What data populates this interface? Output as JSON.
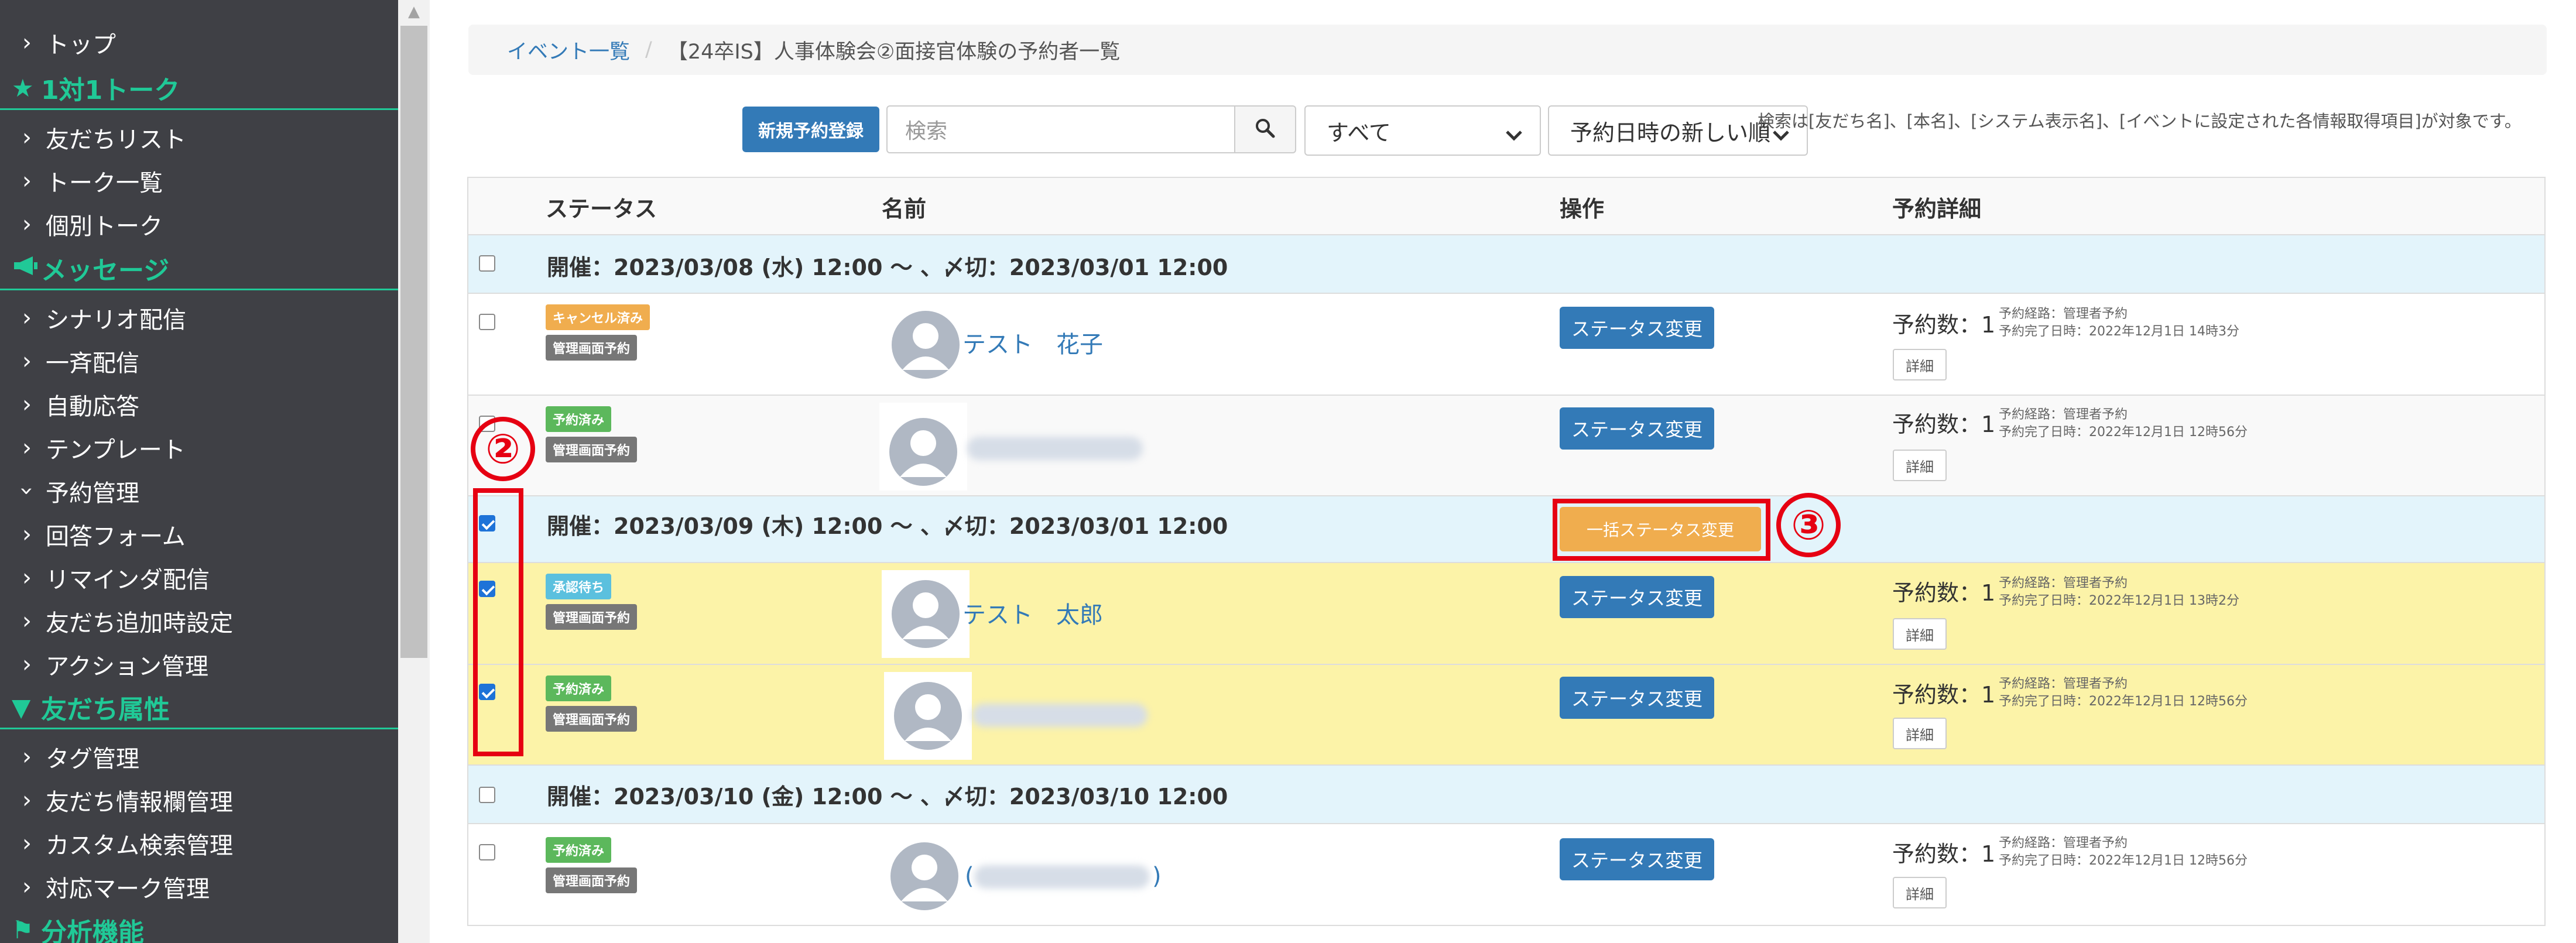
{
  "sidebar": {
    "items": [
      {
        "kind": "item",
        "label": "トップ"
      },
      {
        "kind": "section",
        "label": "1対1トーク",
        "icon": "star-icon"
      },
      {
        "kind": "item",
        "label": "友だちリスト"
      },
      {
        "kind": "item",
        "label": "トーク一覧"
      },
      {
        "kind": "item",
        "label": "個別トーク"
      },
      {
        "kind": "section",
        "label": "メッセージ",
        "icon": "megaphone-icon"
      },
      {
        "kind": "item",
        "label": "シナリオ配信"
      },
      {
        "kind": "item",
        "label": "一斉配信"
      },
      {
        "kind": "item",
        "label": "自動応答"
      },
      {
        "kind": "item",
        "label": "テンプレート"
      },
      {
        "kind": "item-expanded",
        "label": "予約管理"
      },
      {
        "kind": "item",
        "label": "回答フォーム"
      },
      {
        "kind": "item",
        "label": "リマインダ配信"
      },
      {
        "kind": "item",
        "label": "友だち追加時設定"
      },
      {
        "kind": "item",
        "label": "アクション管理"
      },
      {
        "kind": "section",
        "label": "友だち属性",
        "icon": "filter-icon"
      },
      {
        "kind": "item",
        "label": "タグ管理"
      },
      {
        "kind": "item",
        "label": "友だち情報欄管理"
      },
      {
        "kind": "item",
        "label": "カスタム検索管理"
      },
      {
        "kind": "item",
        "label": "対応マーク管理"
      },
      {
        "kind": "section",
        "label": "分析機能",
        "icon": "flag-icon"
      }
    ]
  },
  "breadcrumb": {
    "link": "イベント一覧",
    "separator": "/",
    "current": "【24卒IS】人事体験会②面接官体験の予約者一覧"
  },
  "toolbar": {
    "new_button": "新規予約登録",
    "search_placeholder": "検索",
    "filter_select": "すべて",
    "sort_select": "予約日時の新しい順",
    "hint": "検索は[友だち名]、[本名]、[システム表示名]、[イベントに設定された各情報取得項目]が対象です。"
  },
  "table": {
    "headers": {
      "status": "ステータス",
      "name": "名前",
      "action": "操作",
      "detail": "予約詳細"
    },
    "groups": [
      {
        "date": "開催：2023/03/08 (水) 12:00 〜 、〆切：2023/03/01 12:00",
        "checked": false
      },
      {
        "date": "開催：2023/03/09 (木) 12:00 〜 、〆切：2023/03/01 12:00",
        "checked": true
      },
      {
        "date": "開催：2023/03/10 (金) 12:00 〜 、〆切：2023/03/10 12:00",
        "checked": false
      }
    ],
    "rows": [
      {
        "checked": false,
        "status": "キャンセル済み",
        "status_color": "#f0ad4e",
        "source": "管理画面予約",
        "name": "テスト　花子",
        "count": "予約数：1",
        "route": "予約経路：管理者予約",
        "completed": "予約完了日時：2022年12月1日 14時3分"
      },
      {
        "checked": false,
        "status": "予約済み",
        "status_color": "#5cb85c",
        "source": "管理画面予約",
        "name": "",
        "count": "予約数：1",
        "route": "予約経路：管理者予約",
        "completed": "予約完了日時：2022年12月1日 12時56分"
      },
      {
        "checked": true,
        "status": "承認待ち",
        "status_color": "#5bc0de",
        "source": "管理画面予約",
        "name": "テスト　太郎",
        "count": "予約数：1",
        "route": "予約経路：管理者予約",
        "completed": "予約完了日時：2022年12月1日 13時2分"
      },
      {
        "checked": true,
        "status": "予約済み",
        "status_color": "#5cb85c",
        "source": "管理画面予約",
        "name": "",
        "count": "予約数：1",
        "route": "予約経路：管理者予約",
        "completed": "予約完了日時：2022年12月1日 12時56分"
      },
      {
        "checked": false,
        "status": "予約済み",
        "status_color": "#5cb85c",
        "source": "管理画面予約",
        "name": "",
        "name_fragment_left": "(",
        "name_fragment_right": ")",
        "count": "予約数：1",
        "route": "予約経路：管理者予約",
        "completed": "予約完了日時：2022年12月1日 12時56分"
      }
    ],
    "status_change_button": "ステータス変更",
    "detail_button": "詳細",
    "bulk_button": "一括ステータス変更"
  },
  "annotations": {
    "marker_2": "②",
    "marker_3": "③",
    "highlight_color": "#e60012"
  }
}
